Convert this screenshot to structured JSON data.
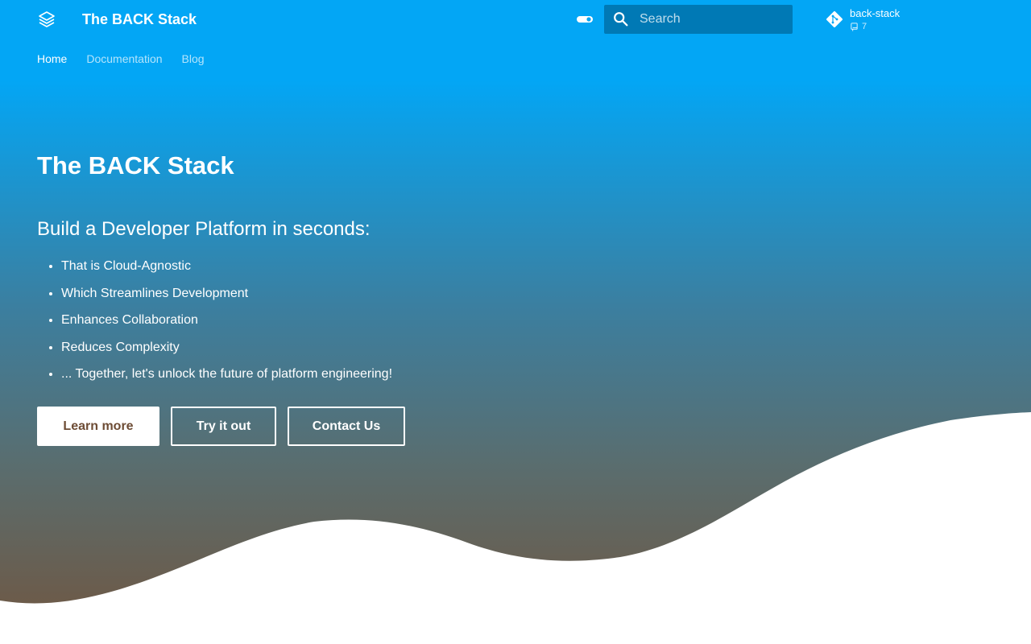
{
  "header": {
    "site_title": "The BACK Stack",
    "logo_icon": "layers-icon",
    "toggle_icon": "toggle-on-icon",
    "search": {
      "placeholder": "Search",
      "icon": "search-icon"
    },
    "repo": {
      "icon": "git-icon",
      "name": "back-stack",
      "facts_icon": "repo-icon",
      "count": "7"
    }
  },
  "tabs": [
    {
      "label": "Home",
      "active": true
    },
    {
      "label": "Documentation",
      "active": false
    },
    {
      "label": "Blog",
      "active": false
    }
  ],
  "hero": {
    "title": "The BACK Stack",
    "subtitle": "Build a Developer Platform in seconds:",
    "features": [
      "That is Cloud-Agnostic",
      "Which Streamlines Development",
      "Enhances Collaboration",
      "Reduces Complexity",
      "... Together, let's unlock the future of platform engineering!"
    ],
    "buttons": {
      "learn_more": "Learn more",
      "try_it_out": "Try it out",
      "contact_us": "Contact Us"
    }
  },
  "colors": {
    "primary": "#03a6f5",
    "search_bg": "#0079b5",
    "accent_brown": "#6d4c35",
    "background": "#ffffff"
  }
}
